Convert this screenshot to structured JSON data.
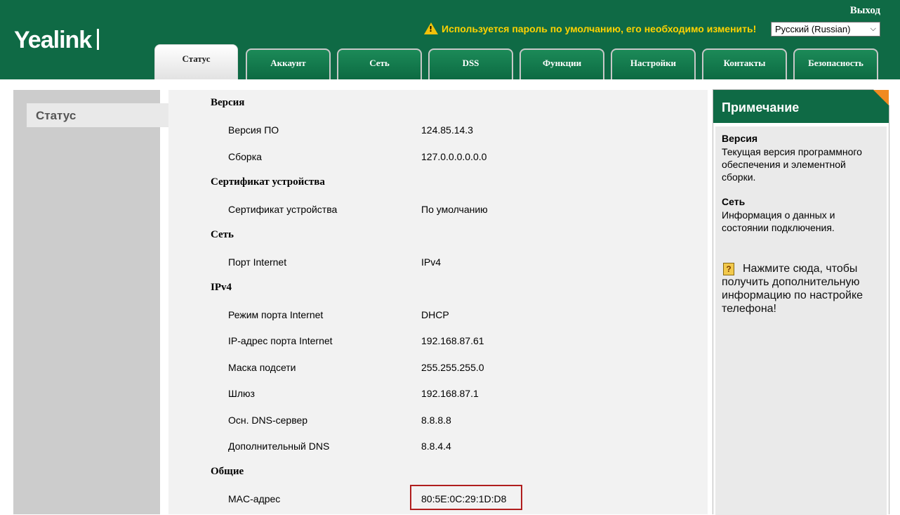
{
  "header": {
    "logo": "Yealink",
    "logout": "Выход",
    "warning": "Используется пароль по умолчанию, его необходимо изменить!",
    "language": "Русский (Russian)"
  },
  "tabs": [
    {
      "label": "Статус",
      "active": true
    },
    {
      "label": "Аккаунт"
    },
    {
      "label": "Сеть"
    },
    {
      "label": "DSS"
    },
    {
      "label": "Функции"
    },
    {
      "label": "Настройки"
    },
    {
      "label": "Контакты"
    },
    {
      "label": "Безопасность"
    }
  ],
  "sidebar": {
    "items": [
      {
        "label": "Статус"
      }
    ]
  },
  "main": {
    "version_title": "Версия",
    "fw_label": "Версия ПО",
    "fw_value": "124.85.14.3",
    "build_label": "Сборка",
    "build_value": "127.0.0.0.0.0.0",
    "cert_title": "Сертификат устройства",
    "cert_label": "Сертификат устройства",
    "cert_value": "По умолчанию",
    "net_title": "Сеть",
    "port_label": "Порт Internet",
    "port_value": "IPv4",
    "ipv4_title": "IPv4",
    "mode_label": "Режим порта Internet",
    "mode_value": "DHCP",
    "ip_label": "IP-адрес порта Internet",
    "ip_value": "192.168.87.61",
    "mask_label": "Маска подсети",
    "mask_value": "255.255.255.0",
    "gw_label": "Шлюз",
    "gw_value": "192.168.87.1",
    "dns1_label": "Осн. DNS-сервер",
    "dns1_value": "8.8.8.8",
    "dns2_label": "Дополнительный DNS",
    "dns2_value": "8.8.4.4",
    "general_title": "Общие",
    "mac_label": "MAC-адрес",
    "mac_value": "80:5E:0C:29:1D:D8"
  },
  "note": {
    "title": "Примечание",
    "h1": "Версия",
    "p1": "Текущая версия программного обеспечения и элементной сборки.",
    "h2": "Сеть",
    "p2": "Информация о данных и состоянии подключения.",
    "help": "Нажмите сюда, чтобы получить дополнительную информацию по настройке телефона!"
  },
  "colors": {
    "brand": "#0f6a45",
    "warning": "#ffd200",
    "highlight": "#b01e1e",
    "note_corner": "#f08a20"
  }
}
